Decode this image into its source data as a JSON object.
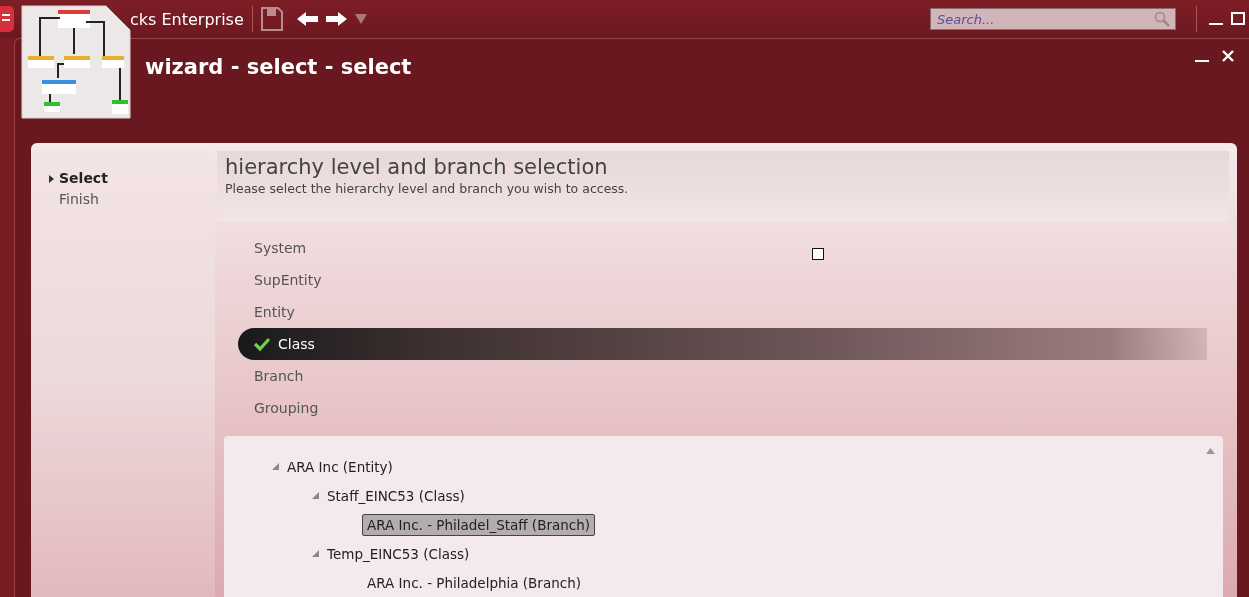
{
  "app": {
    "title": "cks Enterprise"
  },
  "search": {
    "placeholder": "Search..."
  },
  "wizard": {
    "title": "wizard - select - select"
  },
  "steps": [
    {
      "label": "Select",
      "selected": true
    },
    {
      "label": "Finish",
      "selected": false
    }
  ],
  "page": {
    "heading": "hierarchy level and branch selection",
    "description": "Please select the hierarchy level and branch you wish to access."
  },
  "levels": [
    {
      "label": "System",
      "selected": false
    },
    {
      "label": "SupEntity",
      "selected": false
    },
    {
      "label": "Entity",
      "selected": false
    },
    {
      "label": "Class",
      "selected": true
    },
    {
      "label": "Branch",
      "selected": false
    },
    {
      "label": "Grouping",
      "selected": false
    }
  ],
  "tree": [
    {
      "label": "ARA Inc (Entity)",
      "expanded": true,
      "selected": false,
      "children": [
        {
          "label": "Staff_EINC53 (Class)",
          "expanded": true,
          "selected": false,
          "children": [
            {
              "label": "ARA Inc. - Philadel_Staff (Branch)",
              "expanded": false,
              "selected": true
            }
          ]
        },
        {
          "label": "Temp_EINC53 (Class)",
          "expanded": true,
          "selected": false,
          "children": [
            {
              "label": "ARA Inc. - Philadelphia (Branch)",
              "expanded": false,
              "selected": false
            }
          ]
        }
      ]
    }
  ]
}
